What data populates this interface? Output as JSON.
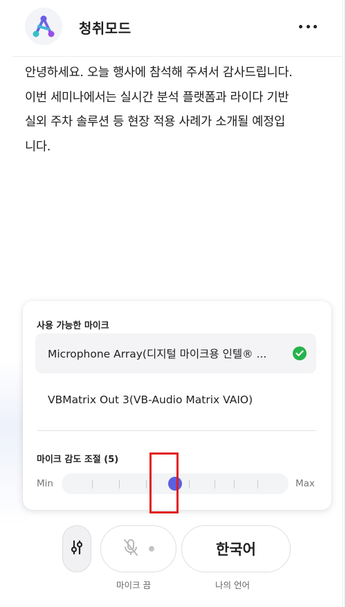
{
  "header": {
    "app_title": "청취모드",
    "logo_icon": "triangle-nodes-logo",
    "more_icon": "more-horizontal-icon"
  },
  "transcript": {
    "lines": [
      "안녕하세요. 오늘 행사에 참석해 주셔서 감사드립니다.",
      "이번 세미나에서는 실시간 분석 플랫폼과 라이다 기반",
      "실외 주차 솔루션 등 현장 적용 사례가 소개될 예정입",
      "니다."
    ]
  },
  "mic_panel": {
    "heading": "사용 가능한 마이크",
    "options": [
      {
        "label": "Microphone Array(디지털 마이크용 인텔® ...",
        "selected": true
      },
      {
        "label": "VBMatrix Out 3(VB-Audio Matrix VAIO)",
        "selected": false
      }
    ],
    "sensitivity": {
      "label": "마이크 감도 조절 (5)",
      "min_label": "Min",
      "max_label": "Max",
      "value": 5,
      "min": 1,
      "max": 9,
      "thumb_color": "#5b5fe0"
    }
  },
  "controls": {
    "settings_icon": "sliders-icon",
    "mic_icon": "mic-off-icon",
    "mic_caption": "마이크 끔",
    "language_label": "한국어",
    "language_caption": "나의 언어"
  },
  "colors": {
    "accent": "#5b5fe0",
    "check_green": "#26b34a",
    "highlight_red": "#e21b1b"
  }
}
